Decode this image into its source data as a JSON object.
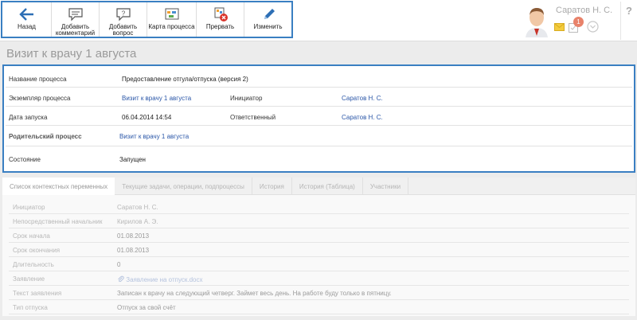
{
  "toolbar": {
    "buttons": [
      {
        "name": "back",
        "label": "Назад",
        "icon": "arrow-left-icon"
      },
      {
        "name": "add-comment",
        "label": "Добавить комментарий",
        "icon": "comment-icon"
      },
      {
        "name": "add-question",
        "label": "Добавить вопрос",
        "icon": "question-icon"
      },
      {
        "name": "process-map",
        "label": "Карта процесса",
        "icon": "process-map-icon"
      },
      {
        "name": "abort",
        "label": "Прервать",
        "icon": "abort-icon"
      },
      {
        "name": "edit",
        "label": "Изменить",
        "icon": "pencil-icon"
      }
    ]
  },
  "user": {
    "name": "Саратов Н. С.",
    "notification_count": "1"
  },
  "help_label": "?",
  "page_title": "Визит к врачу 1 августа",
  "info": {
    "process_name_label": "Название процесса",
    "process_name_value": "Предоставление отгула/отпуска (версия 2)",
    "instance_label": "Экземпляр процесса",
    "instance_value": "Визит к врачу 1 августа",
    "initiator_label": "Инициатор",
    "initiator_value": "Саратов Н. С.",
    "start_date_label": "Дата запуска",
    "start_date_value": "06.04.2014 14:54",
    "responsible_label": "Ответственный",
    "responsible_value": "Саратов Н. С.",
    "parent_label": "Родительский процесс",
    "parent_value": "Визит к врачу 1 августа",
    "state_label": "Состояние",
    "state_value": "Запущен"
  },
  "tabs": [
    "Список контекстных переменных",
    "Текущие задачи, операции, подпроцессы",
    "История",
    "История (Таблица)",
    "Участники"
  ],
  "variables": [
    {
      "name": "Инициатор",
      "value": "Саратов Н. С."
    },
    {
      "name": "Непосредственный начальник",
      "value": "Кирилов А. Э."
    },
    {
      "name": "Срок начала",
      "value": "01.08.2013"
    },
    {
      "name": "Срок окончания",
      "value": "01.08.2013"
    },
    {
      "name": "Длительность",
      "value": "0"
    },
    {
      "name": "Заявление",
      "value": "Заявление на отпуск.docx"
    },
    {
      "name": "Текст заявления",
      "value": "Записан к врачу на следующий четверг. Займет весь день. На работе буду только в пятницу."
    },
    {
      "name": "Тип отпуска",
      "value": "Отпуск за свой счёт"
    }
  ],
  "colors": {
    "highlight_border": "#3a7fc2",
    "link": "#2b57a8",
    "abort_badge": "#d9342b",
    "notification_badge": "#e8826a"
  }
}
